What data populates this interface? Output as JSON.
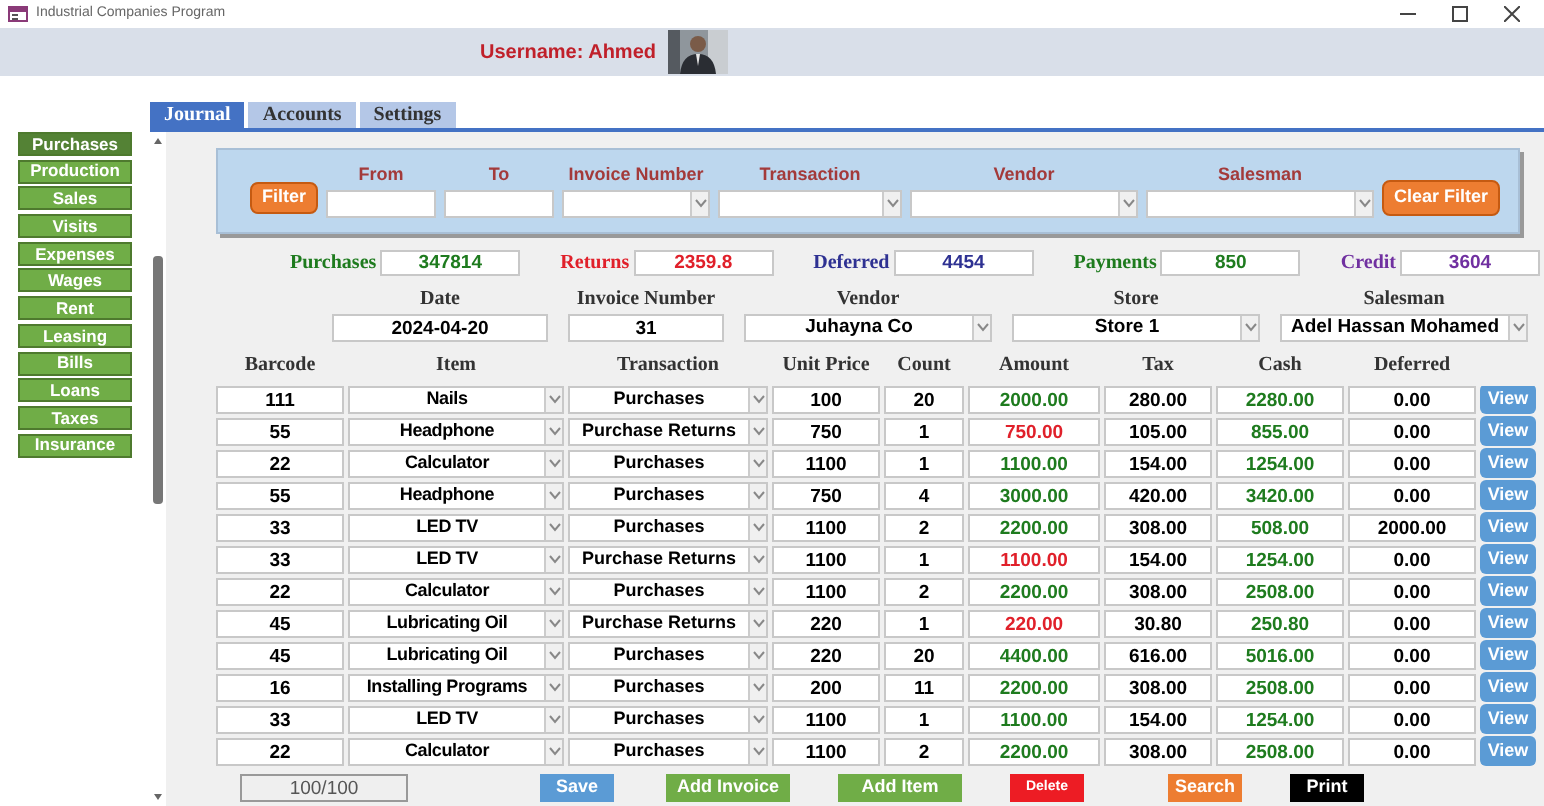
{
  "window": {
    "title": "Industrial Companies Program"
  },
  "header": {
    "username": "Username: Ahmed"
  },
  "tabs": [
    {
      "label": "Journal",
      "selected": true
    },
    {
      "label": "Accounts",
      "selected": false
    },
    {
      "label": "Settings",
      "selected": false
    }
  ],
  "sidebar": [
    {
      "label": "Purchases",
      "selected": true
    },
    {
      "label": "Production",
      "selected": false
    },
    {
      "label": "Sales",
      "selected": false
    },
    {
      "label": "Visits",
      "selected": false
    },
    {
      "label": "Expenses",
      "selected": false
    },
    {
      "label": "Wages",
      "selected": false
    },
    {
      "label": "Rent",
      "selected": false
    },
    {
      "label": "Leasing",
      "selected": false
    },
    {
      "label": "Bills",
      "selected": false
    },
    {
      "label": "Loans",
      "selected": false
    },
    {
      "label": "Taxes",
      "selected": false
    },
    {
      "label": "Insurance",
      "selected": false
    }
  ],
  "filter": {
    "button": "Filter",
    "fields": [
      {
        "label": "From",
        "kind": "text"
      },
      {
        "label": "To",
        "kind": "text"
      },
      {
        "label": "Invoice Number",
        "kind": "select"
      },
      {
        "label": "Transaction",
        "kind": "select"
      },
      {
        "label": "Vendor",
        "kind": "select"
      },
      {
        "label": "Salesman",
        "kind": "select"
      }
    ],
    "clear_button": "Clear Filter"
  },
  "totals": [
    {
      "label": "Purchases",
      "value": "347814",
      "color": "#1e7b1e"
    },
    {
      "label": "Returns",
      "value": "2359.8",
      "color": "#e0202a"
    },
    {
      "label": "Deferred",
      "value": "4454",
      "color": "#2e3192"
    },
    {
      "label": "Payments",
      "value": "850",
      "color": "#1e7b1e"
    },
    {
      "label": "Credit",
      "value": "3604",
      "color": "#7030a0"
    }
  ],
  "invoice": [
    {
      "label": "Date",
      "value": "2024-04-20",
      "kind": "text"
    },
    {
      "label": "Invoice Number",
      "value": "31",
      "kind": "text"
    },
    {
      "label": "Vendor",
      "value": "Juhayna Co",
      "kind": "select"
    },
    {
      "label": "Store",
      "value": "Store 1",
      "kind": "select"
    },
    {
      "label": "Salesman",
      "value": "Adel Hassan Mohamed",
      "kind": "select"
    }
  ],
  "table": {
    "columns": [
      "Barcode",
      "Item",
      "Transaction",
      "Unit Price",
      "Count",
      "Amount",
      "Tax",
      "Cash",
      "Deferred"
    ],
    "rows": [
      {
        "barcode": "111",
        "item": "Nails",
        "transaction": "Purchases",
        "unit_price": "100",
        "count": "20",
        "amount": "2000.00",
        "tax": "280.00",
        "cash": "2280.00",
        "deferred": "0.00",
        "returns": false,
        "action": "View"
      },
      {
        "barcode": "55",
        "item": "Headphone",
        "transaction": "Purchase Returns",
        "unit_price": "750",
        "count": "1",
        "amount": "750.00",
        "tax": "105.00",
        "cash": "855.00",
        "deferred": "0.00",
        "returns": true,
        "action": "View"
      },
      {
        "barcode": "22",
        "item": "Calculator",
        "transaction": "Purchases",
        "unit_price": "1100",
        "count": "1",
        "amount": "1100.00",
        "tax": "154.00",
        "cash": "1254.00",
        "deferred": "0.00",
        "returns": false,
        "action": "View"
      },
      {
        "barcode": "55",
        "item": "Headphone",
        "transaction": "Purchases",
        "unit_price": "750",
        "count": "4",
        "amount": "3000.00",
        "tax": "420.00",
        "cash": "3420.00",
        "deferred": "0.00",
        "returns": false,
        "action": "View"
      },
      {
        "barcode": "33",
        "item": "LED TV",
        "transaction": "Purchases",
        "unit_price": "1100",
        "count": "2",
        "amount": "2200.00",
        "tax": "308.00",
        "cash": "508.00",
        "deferred": "2000.00",
        "returns": false,
        "action": "View"
      },
      {
        "barcode": "33",
        "item": "LED TV",
        "transaction": "Purchase Returns",
        "unit_price": "1100",
        "count": "1",
        "amount": "1100.00",
        "tax": "154.00",
        "cash": "1254.00",
        "deferred": "0.00",
        "returns": true,
        "action": "View"
      },
      {
        "barcode": "22",
        "item": "Calculator",
        "transaction": "Purchases",
        "unit_price": "1100",
        "count": "2",
        "amount": "2200.00",
        "tax": "308.00",
        "cash": "2508.00",
        "deferred": "0.00",
        "returns": false,
        "action": "View"
      },
      {
        "barcode": "45",
        "item": "Lubricating Oil",
        "transaction": "Purchase Returns",
        "unit_price": "220",
        "count": "1",
        "amount": "220.00",
        "tax": "30.80",
        "cash": "250.80",
        "deferred": "0.00",
        "returns": true,
        "action": "View"
      },
      {
        "barcode": "45",
        "item": "Lubricating Oil",
        "transaction": "Purchases",
        "unit_price": "220",
        "count": "20",
        "amount": "4400.00",
        "tax": "616.00",
        "cash": "5016.00",
        "deferred": "0.00",
        "returns": false,
        "action": "View"
      },
      {
        "barcode": "16",
        "item": "Installing Programs",
        "transaction": "Purchases",
        "unit_price": "200",
        "count": "11",
        "amount": "2200.00",
        "tax": "308.00",
        "cash": "2508.00",
        "deferred": "0.00",
        "returns": false,
        "action": "View"
      },
      {
        "barcode": "33",
        "item": "LED TV",
        "transaction": "Purchases",
        "unit_price": "1100",
        "count": "1",
        "amount": "1100.00",
        "tax": "154.00",
        "cash": "1254.00",
        "deferred": "0.00",
        "returns": false,
        "action": "View"
      },
      {
        "barcode": "22",
        "item": "Calculator",
        "transaction": "Purchases",
        "unit_price": "1100",
        "count": "2",
        "amount": "2200.00",
        "tax": "308.00",
        "cash": "2508.00",
        "deferred": "0.00",
        "returns": false,
        "action": "View"
      }
    ]
  },
  "footer": {
    "record": "100/100",
    "buttons": [
      {
        "label": "Save",
        "color": "#5b9bd5"
      },
      {
        "label": "Add Invoice",
        "color": "#70ad47"
      },
      {
        "label": "Add Item",
        "color": "#70ad47"
      },
      {
        "label": "Delete",
        "color": "#ed1c24"
      },
      {
        "label": "Search",
        "color": "#ed7d31"
      },
      {
        "label": "Print",
        "color": "#000000"
      }
    ]
  }
}
